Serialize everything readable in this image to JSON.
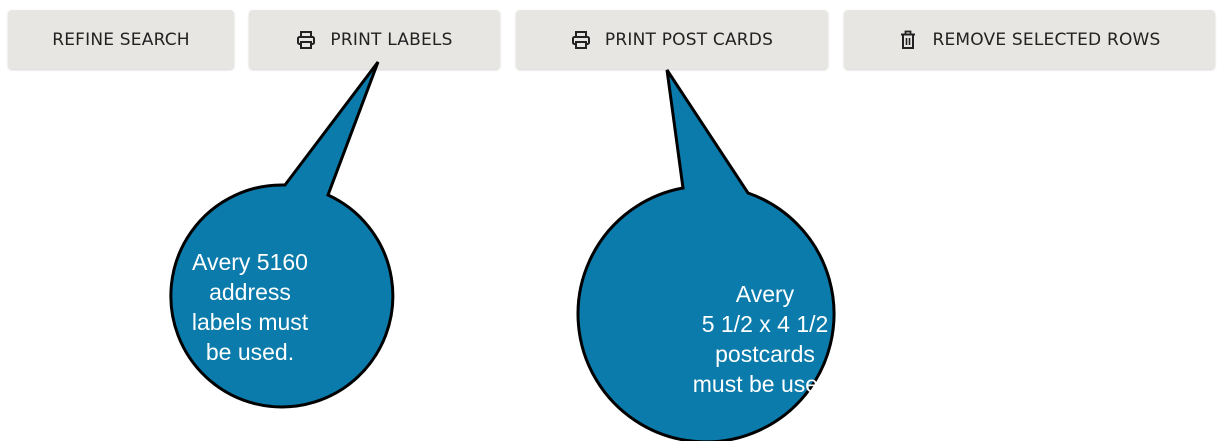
{
  "toolbar": {
    "refine_label": "REFINE SEARCH",
    "print_labels_label": "PRINT LABELS",
    "print_postcards_label": "PRINT POST CARDS",
    "remove_label": "REMOVE SELECTED ROWS"
  },
  "icons": {
    "print": "printer-icon",
    "remove": "trash-icon"
  },
  "callouts": {
    "labels": {
      "lines": [
        "Avery 5160",
        "address",
        "labels must",
        "be used."
      ]
    },
    "postcards": {
      "lines": [
        "Avery",
        "5 1/2 x 4 1/2",
        "postcards",
        "must be used."
      ]
    }
  },
  "colors": {
    "button_bg": "#e8e6e3",
    "button_text": "#222222",
    "callout_fill": "#0b7bab",
    "callout_stroke": "#000000",
    "callout_text": "#ffffff"
  }
}
